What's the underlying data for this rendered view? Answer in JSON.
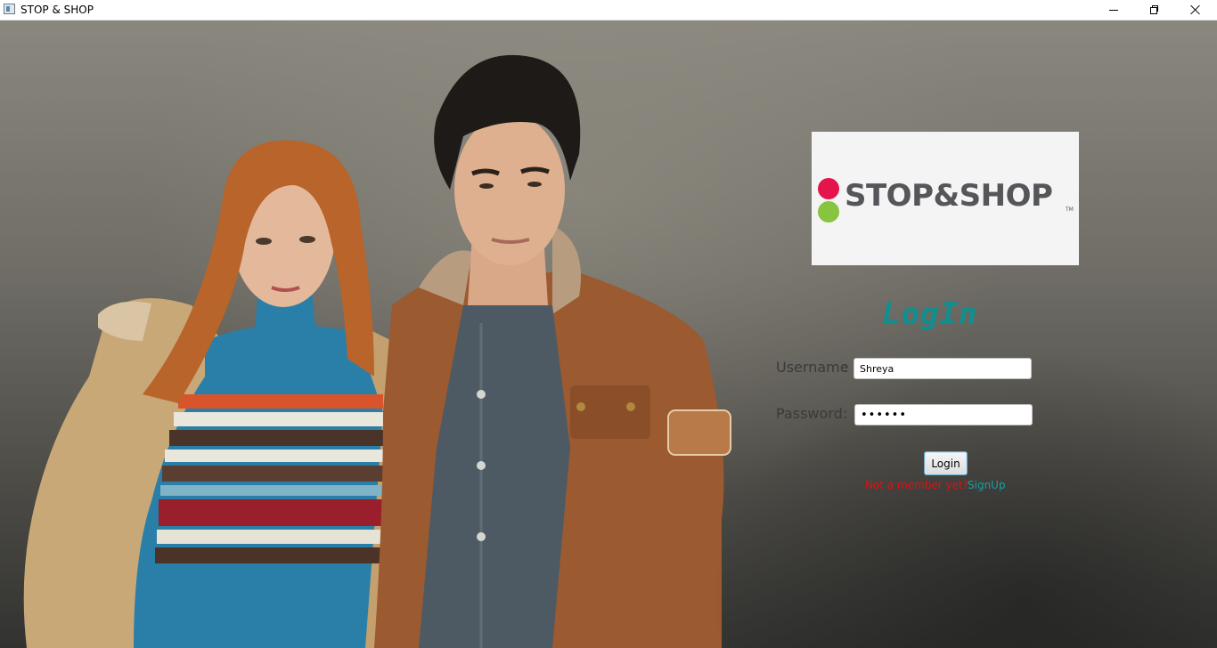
{
  "window": {
    "title": "STOP & SHOP",
    "icon": "app-window-icon",
    "controls": [
      "minimize-icon",
      "restore-icon",
      "close-icon"
    ]
  },
  "logo": {
    "text": "STOP&SHOP",
    "tm": "TM",
    "colors": {
      "dot_top": "#e3154c",
      "dot_bottom": "#87c440",
      "text": "#55565a"
    }
  },
  "login": {
    "heading": "LogIn",
    "heading_color": "#0f8f8f",
    "username_label": "Username",
    "password_label": "Password",
    "separator": ":",
    "username_value": "Shreya",
    "password_value": "••••••",
    "button_label": "Login",
    "not_member_text": "Not a member yet?",
    "signup_text": "SignUp"
  }
}
